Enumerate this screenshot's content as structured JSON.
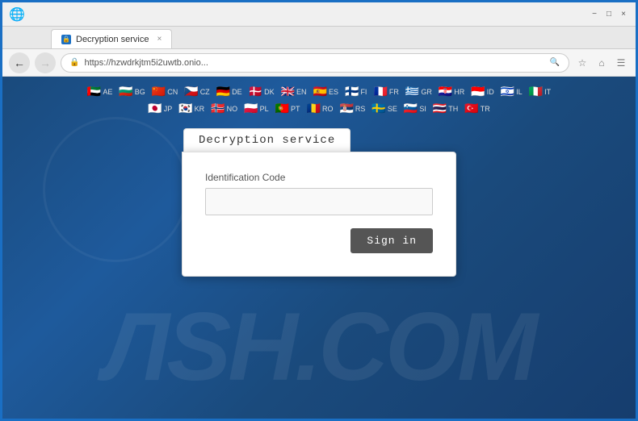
{
  "browser": {
    "title": "Decryption service",
    "url": "https://hzwdrkjtm5i2uwtb.onio...",
    "tab_label": "Decryption service",
    "back_btn": "←",
    "forward_btn": "→",
    "minimize": "−",
    "maximize": "□",
    "close": "×",
    "star_icon": "☆",
    "home_icon": "⌂",
    "menu_icon": "☰"
  },
  "flags": {
    "row1": [
      {
        "emoji": "🇦🇪",
        "code": "AE"
      },
      {
        "emoji": "🇧🇬",
        "code": "BG"
      },
      {
        "emoji": "🇨🇳",
        "code": "CN"
      },
      {
        "emoji": "🇨🇿",
        "code": "CZ"
      },
      {
        "emoji": "🇩🇪",
        "code": "DE"
      },
      {
        "emoji": "🇩🇰",
        "code": "DK"
      },
      {
        "emoji": "🇬🇧",
        "code": "EN"
      },
      {
        "emoji": "🇪🇸",
        "code": "ES"
      },
      {
        "emoji": "🇫🇮",
        "code": "FI"
      },
      {
        "emoji": "🇫🇷",
        "code": "FR"
      },
      {
        "emoji": "🇬🇷",
        "code": "GR"
      },
      {
        "emoji": "🇭🇷",
        "code": "HR"
      },
      {
        "emoji": "🇮🇩",
        "code": "ID"
      },
      {
        "emoji": "🇮🇱",
        "code": "IL"
      },
      {
        "emoji": "🇮🇹",
        "code": "IT"
      }
    ],
    "row2": [
      {
        "emoji": "🇯🇵",
        "code": "JP"
      },
      {
        "emoji": "🇰🇷",
        "code": "KR"
      },
      {
        "emoji": "🇳🇴",
        "code": "NO"
      },
      {
        "emoji": "🇵🇱",
        "code": "PL"
      },
      {
        "emoji": "🇵🇹",
        "code": "PT"
      },
      {
        "emoji": "🇷🇴",
        "code": "RO"
      },
      {
        "emoji": "🇷🇸",
        "code": "RS"
      },
      {
        "emoji": "🇸🇪",
        "code": "SE"
      },
      {
        "emoji": "🇸🇮",
        "code": "SI"
      },
      {
        "emoji": "🇹🇭",
        "code": "TH"
      },
      {
        "emoji": "🇹🇷",
        "code": "TR"
      }
    ]
  },
  "card": {
    "tab_label": "Decryption service",
    "field_label": "Identification Code",
    "field_placeholder": "",
    "signin_label": "Sign in"
  },
  "watermark": {
    "text": "ЛSH.COM"
  }
}
